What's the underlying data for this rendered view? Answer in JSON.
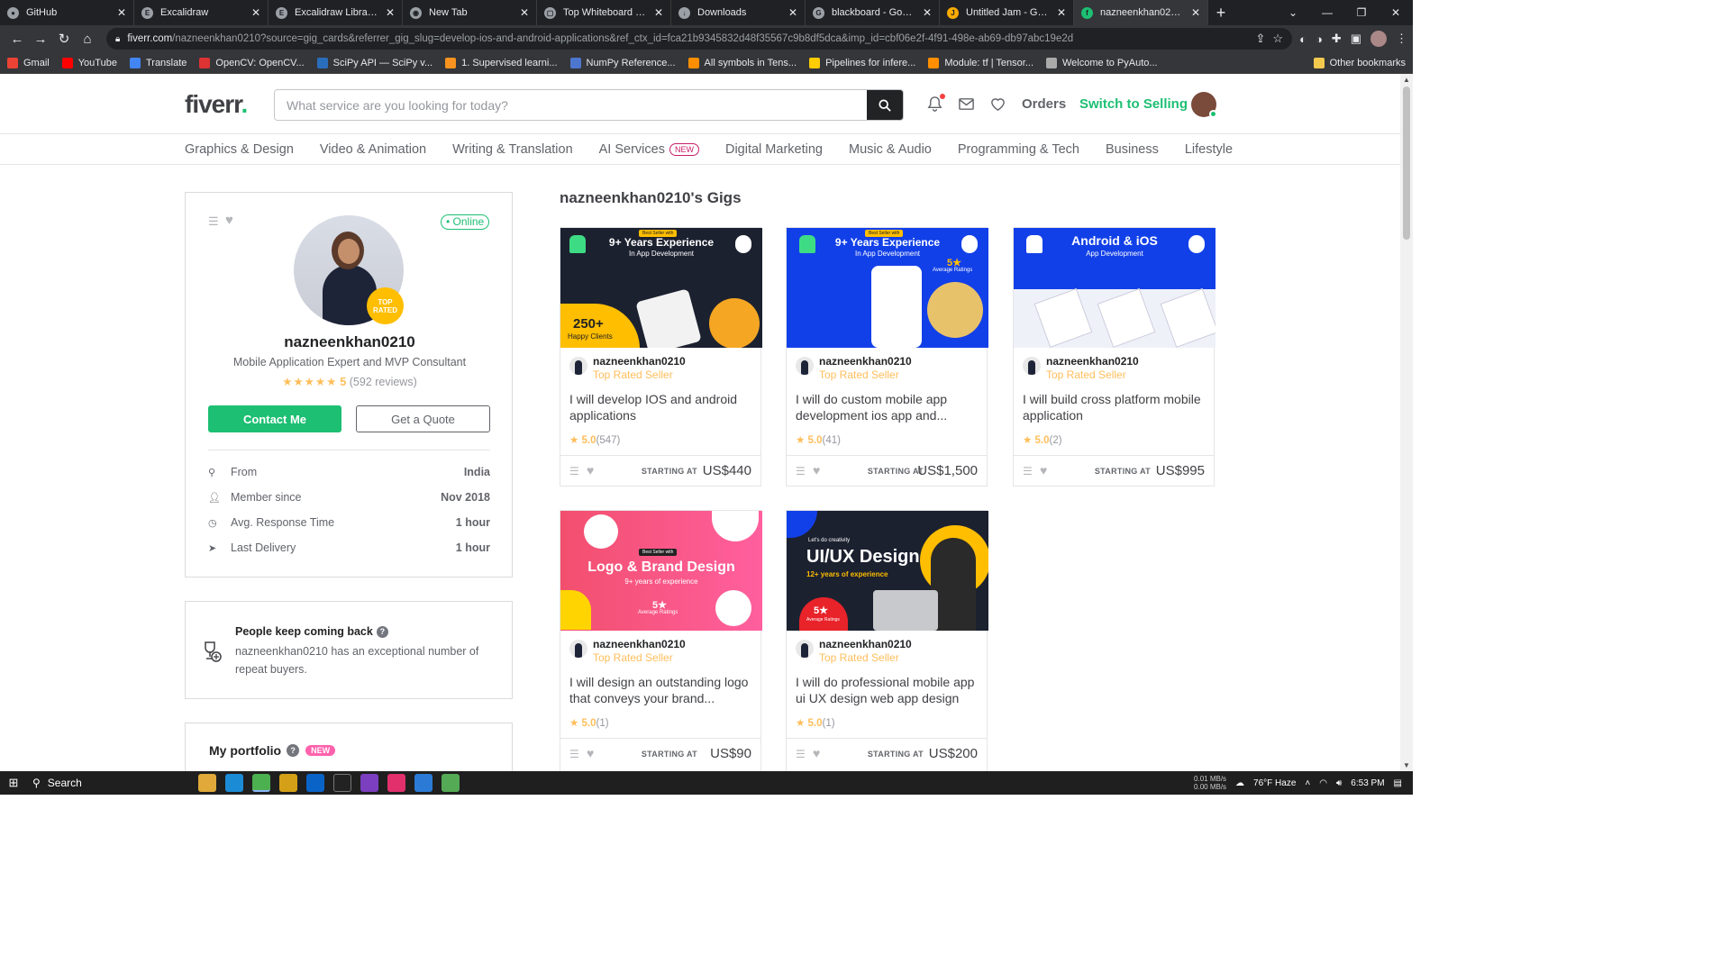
{
  "browser": {
    "tabs": [
      {
        "title": "GitHub",
        "active": false
      },
      {
        "title": "Excalidraw",
        "active": false
      },
      {
        "title": "Excalidraw Libraries",
        "active": false
      },
      {
        "title": "New Tab",
        "active": false
      },
      {
        "title": "Top Whiteboard Optio",
        "active": false
      },
      {
        "title": "Downloads",
        "active": false
      },
      {
        "title": "blackboard - Google S",
        "active": false
      },
      {
        "title": "Untitled Jam - Google",
        "active": false
      },
      {
        "title": "nazneenkhan0210 | Pr",
        "active": true
      }
    ],
    "url_host": "fiverr.com",
    "url_path": "/nazneenkhan0210?source=gig_cards&referrer_gig_slug=develop-ios-and-android-applications&ref_ctx_id=fca21b9345832d48f35567c9b8df5dca&imp_id=cbf06e2f-4f91-498e-ab69-db97abc19e2d",
    "bookmarks": [
      {
        "label": "Gmail",
        "color": "#ea4335"
      },
      {
        "label": "YouTube",
        "color": "#ff0000"
      },
      {
        "label": "Translate",
        "color": "#4285f4"
      },
      {
        "label": "OpenCV: OpenCV...",
        "color": "#d33"
      },
      {
        "label": "SciPy API — SciPy v...",
        "color": "#2a6ebb"
      },
      {
        "label": "1. Supervised learni...",
        "color": "#f7931e"
      },
      {
        "label": "NumPy Reference...",
        "color": "#4d77cf"
      },
      {
        "label": "All symbols in Tens...",
        "color": "#ff8f00"
      },
      {
        "label": "Pipelines for infere...",
        "color": "#ffcc00"
      },
      {
        "label": "Module: tf | Tensor...",
        "color": "#ff8f00"
      },
      {
        "label": "Welcome to PyAuto...",
        "color": "#aaa"
      }
    ],
    "other_bookmarks": "Other bookmarks"
  },
  "header": {
    "logo": "fiverr",
    "logo_dot": ".",
    "search_placeholder": "What service are you looking for today?",
    "orders": "Orders",
    "switch_selling": "Switch to Selling"
  },
  "categories": [
    {
      "label": "Graphics & Design",
      "badge": ""
    },
    {
      "label": "Video & Animation",
      "badge": ""
    },
    {
      "label": "Writing & Translation",
      "badge": ""
    },
    {
      "label": "AI Services",
      "badge": "NEW"
    },
    {
      "label": "Digital Marketing",
      "badge": ""
    },
    {
      "label": "Music & Audio",
      "badge": ""
    },
    {
      "label": "Programming & Tech",
      "badge": ""
    },
    {
      "label": "Business",
      "badge": ""
    },
    {
      "label": "Lifestyle",
      "badge": ""
    }
  ],
  "seller": {
    "status": "• Online",
    "badge": "TOP RATED",
    "username": "nazneenkhan0210",
    "tagline": "Mobile Application Expert and MVP Consultant",
    "rating": 5,
    "rating_display": "5",
    "reviews": "(592 reviews)",
    "contact_btn": "Contact Me",
    "quote_btn": "Get a Quote",
    "stats": [
      {
        "icon": "location-icon",
        "label": "From",
        "value": "India"
      },
      {
        "icon": "user-icon",
        "label": "Member since",
        "value": "Nov 2018"
      },
      {
        "icon": "clock-icon",
        "label": "Avg. Response Time",
        "value": "1 hour"
      },
      {
        "icon": "send-icon",
        "label": "Last Delivery",
        "value": "1 hour"
      }
    ]
  },
  "repeat": {
    "title": "People keep coming back",
    "desc": "nazneenkhan0210 has an exceptional number of repeat buyers."
  },
  "portfolio": {
    "title": "My portfolio",
    "badge": "NEW"
  },
  "gigs_title": "nazneenkhan0210's Gigs",
  "gigs": [
    {
      "seller": "nazneenkhan0210",
      "level": "Top Rated Seller",
      "title": "I will develop IOS and android applications",
      "rating": "5.0",
      "count": "(547)",
      "starting": "STARTING AT",
      "price": "US$440",
      "thumb": {
        "style": "dark",
        "line1": "9+ Years Experience",
        "line2": "In App Development",
        "badge": "Best Seller with",
        "extra": "250+",
        "extra2": "Happy Clients"
      }
    },
    {
      "seller": "nazneenkhan0210",
      "level": "Top Rated Seller",
      "title": "I will do custom mobile app development ios app and...",
      "rating": "5.0",
      "count": "(41)",
      "starting": "STARTING AT",
      "price": "US$1,500",
      "thumb": {
        "style": "blue",
        "line1": "9+ Years Experience",
        "line2": "In App Development",
        "badge": "Best Seller with",
        "extra": "5★",
        "extra2": "Average Ratings"
      }
    },
    {
      "seller": "nazneenkhan0210",
      "level": "Top Rated Seller",
      "title": "I will build cross platform mobile application",
      "rating": "5.0",
      "count": "(2)",
      "starting": "STARTING AT",
      "price": "US$995",
      "thumb": {
        "style": "blue",
        "line1": "Android & iOS",
        "line2": "App Development",
        "badge": "",
        "extra": "",
        "extra2": ""
      }
    },
    {
      "seller": "nazneenkhan0210",
      "level": "Top Rated Seller",
      "title": "I will design an outstanding logo that conveys your brand...",
      "rating": "5.0",
      "count": "(1)",
      "starting": "STARTING AT",
      "price": "US$90",
      "thumb": {
        "style": "pink",
        "line1": "Logo & Brand Design",
        "line2": "9+ years of experience",
        "badge": "Best Seller with",
        "extra": "5★",
        "extra2": "Average Ratings"
      }
    },
    {
      "seller": "nazneenkhan0210",
      "level": "Top Rated Seller",
      "title": "I will do professional mobile app ui UX design web app design",
      "rating": "5.0",
      "count": "(1)",
      "starting": "STARTING AT",
      "price": "US$200",
      "thumb": {
        "style": "dark",
        "line1": "UI/UX Design",
        "line2": "12+ years of experience",
        "badge": "Let's do creativity",
        "extra": "5★",
        "extra2": "Average Ratings"
      }
    }
  ],
  "taskbar": {
    "search": "Search",
    "net_up": "0.01 MB/s",
    "net_down": "0.00 MB/s",
    "weather": "76°F  Haze",
    "time": "6:53 PM"
  }
}
